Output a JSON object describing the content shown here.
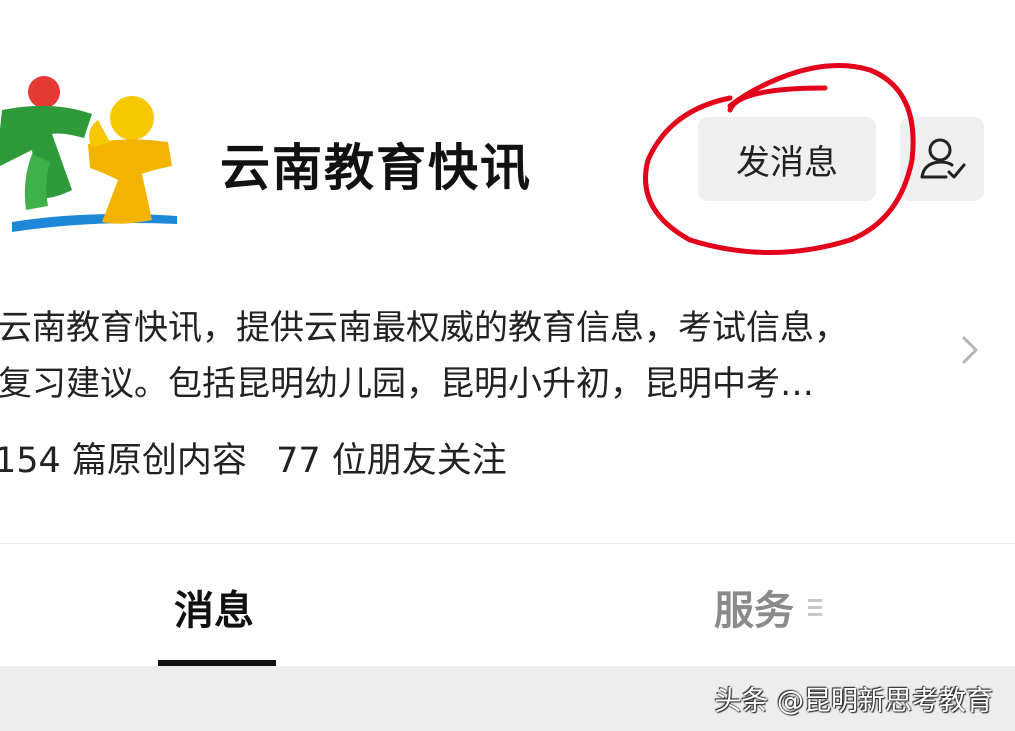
{
  "header": {
    "account_name": "云南教育快讯",
    "send_message_label": "发消息"
  },
  "description": {
    "line1": "云南教育快讯，提供云南最权威的教育信息，考试信息，",
    "line2": "复习建议。包括昆明幼儿园，昆明小升初，昆明中考…"
  },
  "stats": {
    "original_count": "154 篇原创内容",
    "friends_following": "77 位朋友关注"
  },
  "tabs": [
    {
      "label": "消息",
      "active": true
    },
    {
      "label": "服务",
      "active": false
    }
  ],
  "watermark": "头条 @昆明新思考教育",
  "colors": {
    "annotation_red": "#e3001b",
    "button_bg": "#efefef",
    "logo_green": "#2e9a3a",
    "logo_yellow": "#f2b400",
    "logo_blue": "#1e88d8"
  },
  "icons": {
    "follow": "user-check-icon",
    "arrow": "chevron-right-icon",
    "menu": "menu-lines-icon"
  }
}
